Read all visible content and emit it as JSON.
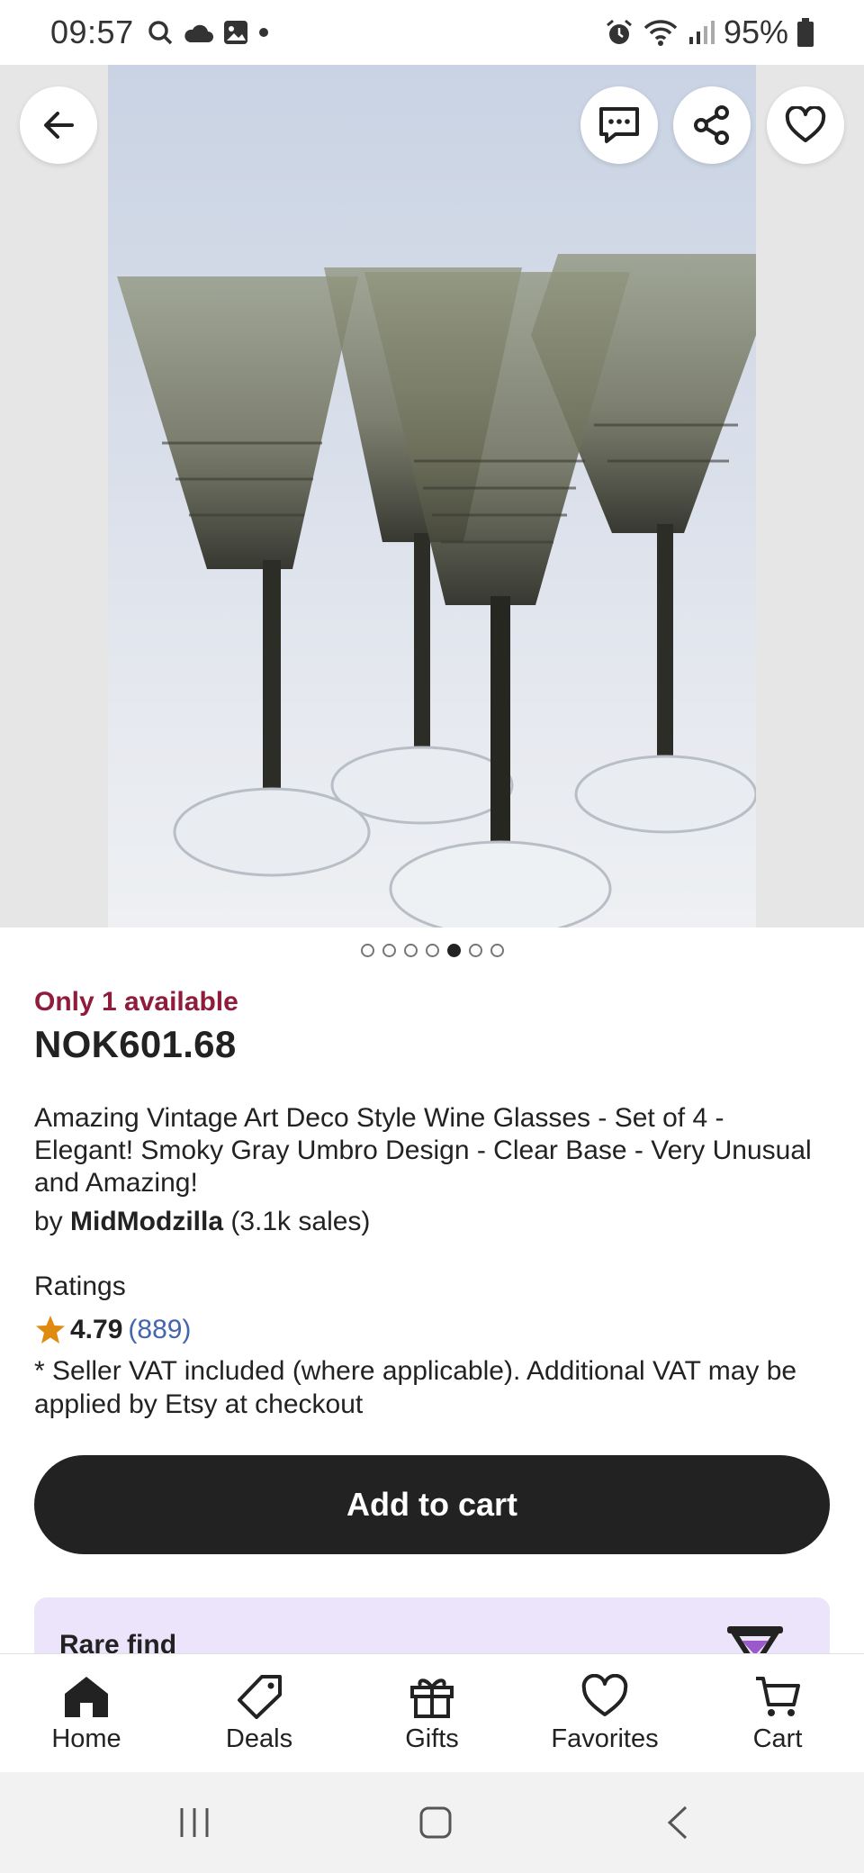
{
  "status_bar": {
    "time": "09:57",
    "battery": "95%"
  },
  "product": {
    "availability": "Only 1 available",
    "price": "NOK601.68",
    "title": "Amazing Vintage Art Deco Style Wine Glasses - Set of 4 - Elegant!  Smoky Gray Umbro Design - Clear Base - Very Unusual and Amazing!",
    "by_prefix": "by",
    "seller": "MidModzilla",
    "sales": "(3.1k sales)",
    "ratings_label": "Ratings",
    "rating_value": "4.79",
    "rating_count": "(889)",
    "vat_note": "* Seller VAT included (where applicable). Additional VAT may be applied by Etsy at checkout",
    "add_to_cart": "Add to cart",
    "rare_find": "Rare find"
  },
  "gallery": {
    "image_count": 7,
    "active_index": 4
  },
  "nav": {
    "items": [
      {
        "label": "Home",
        "icon": "home-icon"
      },
      {
        "label": "Deals",
        "icon": "tag-icon"
      },
      {
        "label": "Gifts",
        "icon": "gift-icon"
      },
      {
        "label": "Favorites",
        "icon": "heart-icon"
      },
      {
        "label": "Cart",
        "icon": "cart-icon"
      }
    ]
  },
  "colors": {
    "availability": "#8f1c3a",
    "button": "#222222",
    "rare_bg": "#ece4fb",
    "star": "#e08a12",
    "link": "#4466aa"
  }
}
